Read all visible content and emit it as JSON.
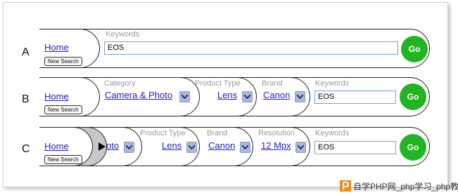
{
  "rows": {
    "a": {
      "label": "A",
      "home": "Home",
      "new_search": "New Search",
      "keywords_label": "Keywords",
      "keywords_value": "EOS",
      "go": "Go"
    },
    "b": {
      "label": "B",
      "home": "Home",
      "new_search": "New Search",
      "category_label": "Category",
      "category_value": "Camera & Photo",
      "product_type_label": "Product Type",
      "product_type_value": "Lens",
      "brand_label": "Brand",
      "brand_value": "Canon",
      "keywords_label": "Keywords",
      "keywords_value": "EOS",
      "go": "Go"
    },
    "c": {
      "label": "C",
      "home": "Home",
      "new_search": "New Search",
      "category_value_clipped": "oto",
      "product_type_label": "Product Type",
      "product_type_value": "Lens",
      "brand_label": "Brand",
      "brand_value": "Canon",
      "resolution_label": "Resolution",
      "resolution_value": "12 Mpx",
      "keywords_label": "Keywords",
      "keywords_value": "EOS",
      "go": "Go"
    }
  },
  "watermark": "自学PHP网_php学习_php教程",
  "colors": {
    "link": "#2020c8",
    "go_button": "#22b422",
    "dropdown": "#a9b9d8",
    "label_grey": "#9a9a9a"
  }
}
